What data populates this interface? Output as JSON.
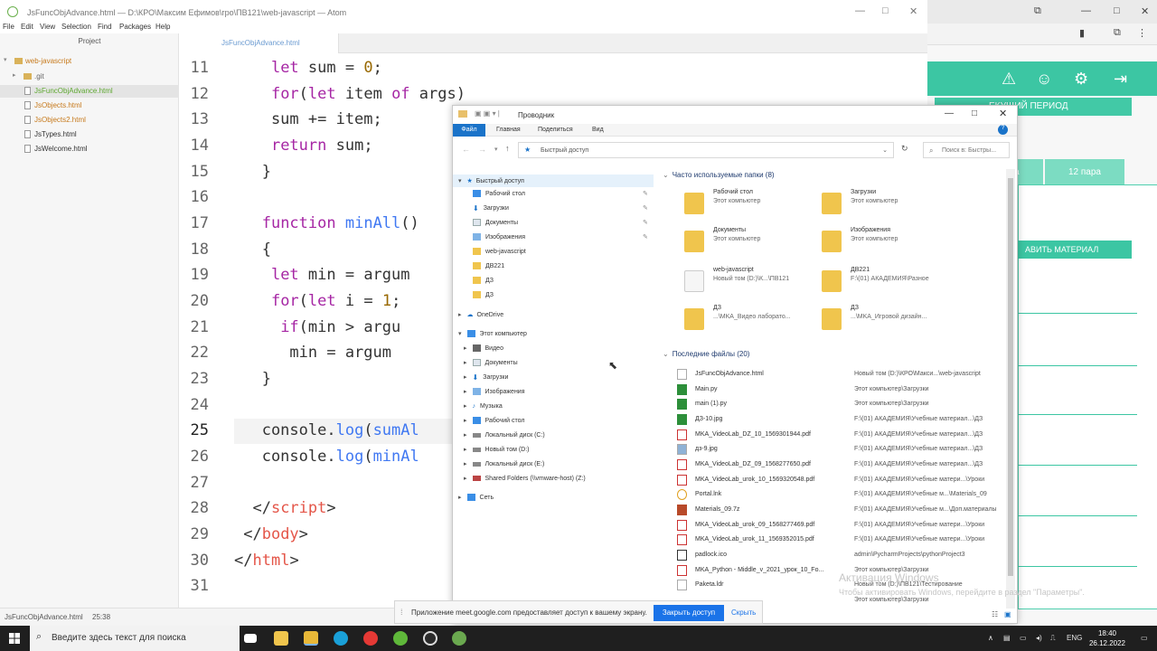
{
  "browser": {
    "period_label": "ЕКУЩИЙ ПЕРИОД",
    "tab_partial": "ра",
    "tab_label": "12 пара",
    "add_material": "АВИТЬ МАТЕРИАЛ"
  },
  "atom": {
    "window_title": "JsFuncObjAdvance.html — D:\\КРО\\Максим Ефимов\\гро\\ПВ121\\web-javascript — Atom",
    "menu": [
      "File",
      "Edit",
      "View",
      "Selection",
      "Find",
      "Packages",
      "Help"
    ],
    "tree_header": "Project",
    "tree": [
      {
        "label": "web-javascript",
        "kind": "root"
      },
      {
        "label": ".git",
        "kind": "folder"
      },
      {
        "label": "JsFuncObjAdvance.html",
        "kind": "file",
        "selected": true
      },
      {
        "label": "JsObjects.html",
        "kind": "file"
      },
      {
        "label": "JsObjects2.html",
        "kind": "file"
      },
      {
        "label": "JsTypes.html",
        "kind": "file"
      },
      {
        "label": "JsWelcome.html",
        "kind": "file"
      }
    ],
    "tab_label": "JsFuncObjAdvance.html",
    "line_numbers": [
      "11",
      "12",
      "13",
      "14",
      "15",
      "16",
      "17",
      "18",
      "19",
      "20",
      "21",
      "22",
      "23",
      "24",
      "25",
      "26",
      "27",
      "28",
      "29",
      "30",
      "31"
    ],
    "status_file": "JsFuncObjAdvance.html",
    "status_pos": "25:38"
  },
  "explorer": {
    "title": "Проводник",
    "ribbon": [
      "Файл",
      "Главная",
      "Поделиться",
      "Вид"
    ],
    "address": "Быстрый доступ",
    "search_placeholder": "Поиск в: Быстры...",
    "nav": [
      {
        "label": "Быстрый доступ",
        "level": 0,
        "selected": true
      },
      {
        "label": "Рабочий стол",
        "level": 1,
        "pinned": true
      },
      {
        "label": "Загрузки",
        "level": 1,
        "pinned": true
      },
      {
        "label": "Документы",
        "level": 1,
        "pinned": true
      },
      {
        "label": "Изображения",
        "level": 1,
        "pinned": true
      },
      {
        "label": "web-javascript",
        "level": 1
      },
      {
        "label": "ДВ221",
        "level": 1
      },
      {
        "label": "ДЗ",
        "level": 1
      },
      {
        "label": "ДЗ",
        "level": 1
      },
      {
        "label": "OneDrive",
        "level": 0
      },
      {
        "label": "Этот компьютер",
        "level": 0
      },
      {
        "label": "Видео",
        "level": 1
      },
      {
        "label": "Документы",
        "level": 1
      },
      {
        "label": "Загрузки",
        "level": 1
      },
      {
        "label": "Изображения",
        "level": 1
      },
      {
        "label": "Музыка",
        "level": 1
      },
      {
        "label": "Рабочий стол",
        "level": 1
      },
      {
        "label": "Локальный диск (C:)",
        "level": 1
      },
      {
        "label": "Новый том (D:)",
        "level": 1
      },
      {
        "label": "Локальный диск (E:)",
        "level": 1
      },
      {
        "label": "Shared Folders (\\\\vmware-host) (Z:)",
        "level": 1
      },
      {
        "label": "Сеть",
        "level": 0
      }
    ],
    "frequent_header": "Часто используемые папки (8)",
    "frequent": [
      {
        "name": "Рабочий стол",
        "sub": "Этот компьютер"
      },
      {
        "name": "Загрузки",
        "sub": "Этот компьютер"
      },
      {
        "name": "Документы",
        "sub": "Этот компьютер"
      },
      {
        "name": "Изображения",
        "sub": "Этот компьютер"
      },
      {
        "name": "web-javascript",
        "sub": "Новый том (D:)\\К...\\ПВ121"
      },
      {
        "name": "ДВ221",
        "sub": "F:\\(01) АКАДЕМИЯ\\Разное"
      },
      {
        "name": "ДЗ",
        "sub": "...\\MKA_Видео лаборато..."
      },
      {
        "name": "ДЗ",
        "sub": "...\\MKA_Игровой дизайн..."
      }
    ],
    "recent_header": "Последние файлы (20)",
    "recent": [
      {
        "name": "JsFuncObjAdvance.html",
        "path": "Новый том (D:)\\КРО\\Макси...\\web-javascript"
      },
      {
        "name": "Main.py",
        "path": "Этот компьютер\\Загрузки"
      },
      {
        "name": "main (1).py",
        "path": "Этот компьютер\\Загрузки"
      },
      {
        "name": "ДЗ-10.jpg",
        "path": "F:\\(01) АКАДЕМИЯ\\Учебные материал...\\ДЗ"
      },
      {
        "name": "MKA_VideoLab_DZ_10_1569301944.pdf",
        "path": "F:\\(01) АКАДЕМИЯ\\Учебные материал...\\ДЗ"
      },
      {
        "name": "дз-9.jpg",
        "path": "F:\\(01) АКАДЕМИЯ\\Учебные материал...\\ДЗ"
      },
      {
        "name": "MKA_VideoLab_DZ_09_1568277650.pdf",
        "path": "F:\\(01) АКАДЕМИЯ\\Учебные материал...\\ДЗ"
      },
      {
        "name": "MKA_VideoLab_urok_10_1569320548.pdf",
        "path": "F:\\(01) АКАДЕМИЯ\\Учебные матери...\\Уроки"
      },
      {
        "name": "Portal.lnk",
        "path": "F:\\(01) АКАДЕМИЯ\\Учебные м...\\Materials_09"
      },
      {
        "name": "Materials_09.7z",
        "path": "F:\\(01) АКАДЕМИЯ\\Учебные м...\\Доп.материалы"
      },
      {
        "name": "MKA_VideoLab_urok_09_1568277469.pdf",
        "path": "F:\\(01) АКАДЕМИЯ\\Учебные матери...\\Уроки"
      },
      {
        "name": "MKA_VideoLab_urok_11_1569352015.pdf",
        "path": "F:\\(01) АКАДЕМИЯ\\Учебные матери...\\Уроки"
      },
      {
        "name": "padlock.ico",
        "path": "admin\\PycharmProjects\\pythonProject3"
      },
      {
        "name": "MKA_Python - Middle_v_2021_урок_10_Fо...",
        "path": "Этот компьютер\\Загрузки"
      },
      {
        "name": "Paketa.ldr",
        "path": "Новый том (D:)\\ПВ121\\Тестирование"
      },
      {
        "name": "",
        "path": "Этот компьютер\\Загрузки"
      }
    ]
  },
  "share": {
    "message": "Приложение meet.google.com предоставляет доступ к вашему экрану.",
    "stop_label": "Закрыть доступ",
    "hide_label": "Скрыть"
  },
  "watermark": {
    "title": "Активация Windows",
    "sub": "Чтобы активировать Windows, перейдите в раздел \"Параметры\"."
  },
  "taskbar": {
    "search_placeholder": "Введите здесь текст для поиска",
    "lang": "ENG",
    "time": "18:40",
    "date": "26.12.2022"
  },
  "colors": {
    "accent_teal": "#3cc6a3",
    "explorer_blue": "#1a73c9",
    "atom_keyword": "#a626a4",
    "atom_function": "#4078f2"
  }
}
